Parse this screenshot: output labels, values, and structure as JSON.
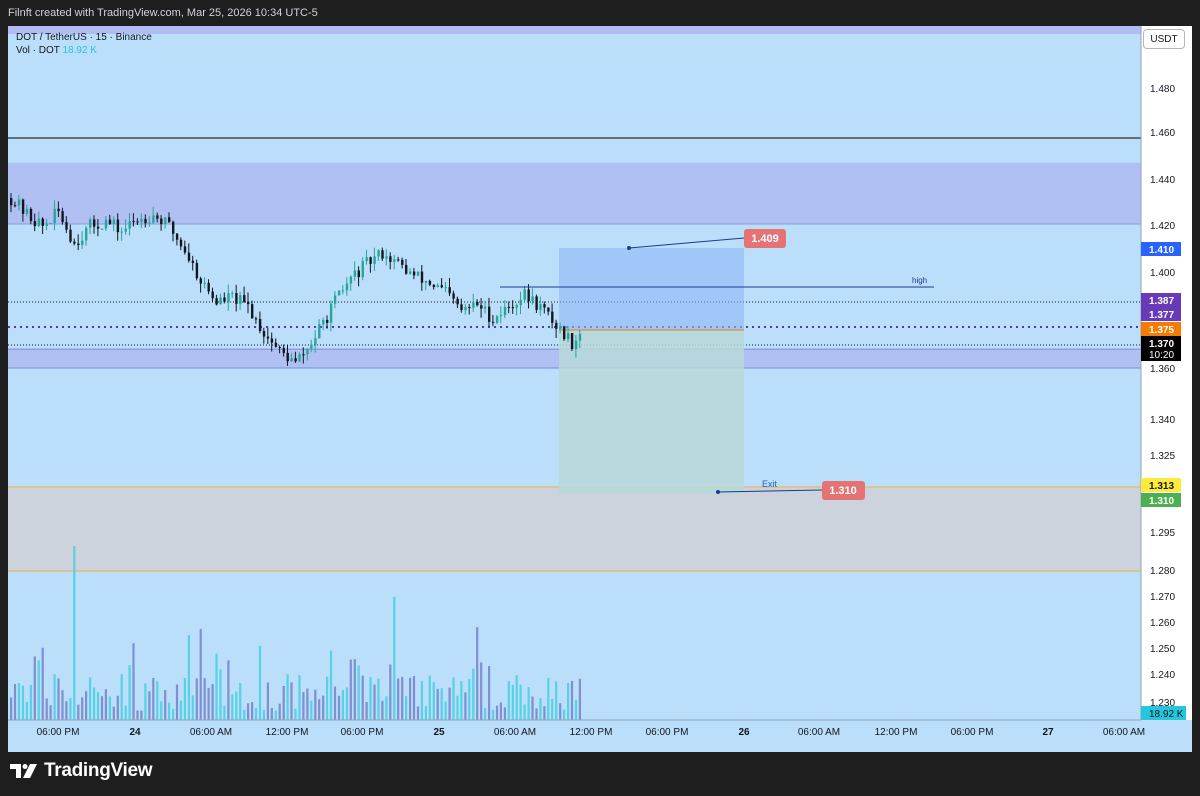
{
  "header": {
    "title": "Filnft created with TradingView.com, Mar 25, 2026 10:34 UTC-5"
  },
  "legend": {
    "symbol_line": "DOT / TetherUS · 15 · Binance",
    "vol_label": "Vol · DOT",
    "vol_value": "18.92 K"
  },
  "currency_button": "USDT",
  "footer": {
    "brand": "TradingView"
  },
  "chart_data": {
    "type": "candlestick",
    "symbol": "DOT / TetherUS",
    "interval": "15",
    "exchange": "Binance",
    "y_range": [
      1.225,
      1.496
    ],
    "x_ticks": [
      "06:00 PM",
      "24",
      "06:00 AM",
      "12:00 PM",
      "06:00 PM",
      "25",
      "06:00 AM",
      "12:00 PM",
      "06:00 PM",
      "26",
      "06:00 AM",
      "12:00 PM",
      "06:00 PM",
      "27",
      "06:00 AM"
    ],
    "y_ticks": [
      "1.480",
      "1.460",
      "1.440",
      "1.420",
      "1.400",
      "1.360",
      "1.340",
      "1.325",
      "1.295",
      "1.280",
      "1.270",
      "1.260",
      "1.250",
      "1.240",
      "1.230"
    ],
    "price_path": [
      [
        0,
        1.432
      ],
      [
        4,
        1.425
      ],
      [
        8,
        1.42
      ],
      [
        12,
        1.426
      ],
      [
        16,
        1.413
      ],
      [
        20,
        1.42
      ],
      [
        24,
        1.422
      ],
      [
        28,
        1.418
      ],
      [
        32,
        1.423
      ],
      [
        36,
        1.425
      ],
      [
        40,
        1.42
      ],
      [
        44,
        1.41
      ],
      [
        48,
        1.397
      ],
      [
        52,
        1.388
      ],
      [
        56,
        1.39
      ],
      [
        60,
        1.386
      ],
      [
        64,
        1.375
      ],
      [
        68,
        1.367
      ],
      [
        72,
        1.362
      ],
      [
        75,
        1.368
      ],
      [
        78,
        1.376
      ],
      [
        82,
        1.388
      ],
      [
        86,
        1.398
      ],
      [
        90,
        1.404
      ],
      [
        94,
        1.409
      ],
      [
        98,
        1.404
      ],
      [
        102,
        1.399
      ],
      [
        106,
        1.396
      ],
      [
        110,
        1.392
      ],
      [
        114,
        1.384
      ],
      [
        118,
        1.387
      ],
      [
        122,
        1.381
      ],
      [
        126,
        1.386
      ],
      [
        130,
        1.391
      ],
      [
        134,
        1.386
      ],
      [
        138,
        1.378
      ],
      [
        142,
        1.371
      ],
      [
        144,
        1.375
      ]
    ],
    "volume_spikes": [
      [
        16,
        18.92
      ],
      [
        48,
        9.9
      ],
      [
        97,
        13.4
      ],
      [
        118,
        10.1
      ]
    ],
    "last_volume": "18.92 K",
    "price_labels": [
      {
        "value": "1.410",
        "color": "#2962ff",
        "text_color": "#ffffff"
      },
      {
        "value": "1.387",
        "color": "#673ab7",
        "text_color": "#ffffff"
      },
      {
        "value": "1.377",
        "color": "#673ab7",
        "text_color": "#ffffff"
      },
      {
        "value": "1.375",
        "color": "#f57c00",
        "text_color": "#ffffff"
      },
      {
        "value": "1.370",
        "color": "#000000",
        "text_color": "#ffffff",
        "sub": "10:20"
      },
      {
        "value": "1.313",
        "color": "#ffeb3b",
        "text_color": "#131722"
      },
      {
        "value": "1.310",
        "color": "#4caf50",
        "text_color": "#ffffff"
      }
    ],
    "annotations": {
      "target_label": "1.409",
      "exit_label": "1.310",
      "exit_text": "Exit",
      "high_text": "high"
    },
    "levels": {
      "black_line": 1.457,
      "dotted_1": 1.387,
      "dotted_2": 1.37,
      "purple_dotted": 1.377
    },
    "zones": {
      "supply": [
        1.421,
        1.447
      ],
      "demand": [
        1.36,
        1.368
      ],
      "lower": [
        1.28,
        1.313
      ]
    },
    "position": {
      "entry": 1.375,
      "target": 1.41,
      "stop": 1.31
    },
    "colors": {
      "up": "#26a69a",
      "down": "#131722",
      "bg": "#bbdefb",
      "zone": "#b0bcf2"
    }
  }
}
